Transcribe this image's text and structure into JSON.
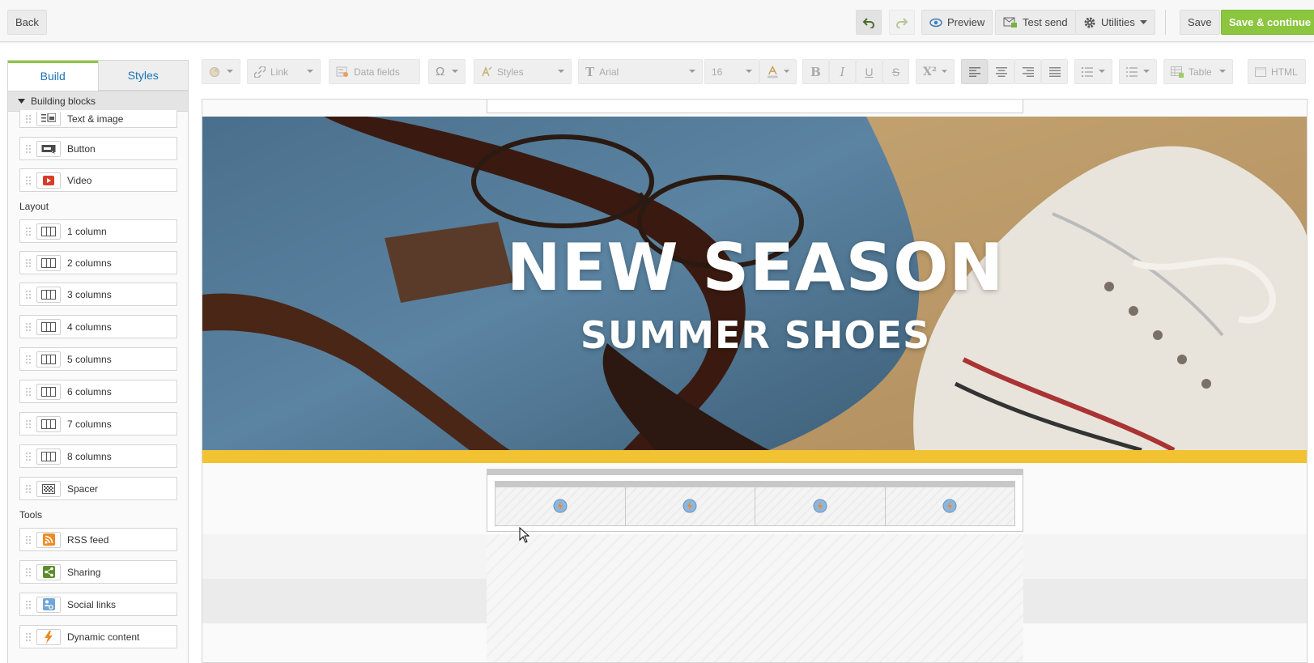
{
  "topbar": {
    "back_label": "Back",
    "preview_label": "Preview",
    "test_send_label": "Test send",
    "utilities_label": "Utilities",
    "save_label": "Save",
    "save_continue_label": "Save & continue",
    "accent_color": "#8cc63e"
  },
  "sidebar": {
    "tabs": [
      {
        "label": "Build",
        "active": true
      },
      {
        "label": "Styles",
        "active": false
      }
    ],
    "section_title": "Building blocks",
    "building_blocks": [
      {
        "label": "Text & image",
        "icon": "text-image-icon"
      },
      {
        "label": "Button",
        "icon": "button-block-icon"
      },
      {
        "label": "Video",
        "icon": "video-icon"
      }
    ],
    "layout_label": "Layout",
    "layout_blocks": [
      {
        "label": "1 column",
        "icon": "columns-icon"
      },
      {
        "label": "2 columns",
        "icon": "columns-icon"
      },
      {
        "label": "3 columns",
        "icon": "columns-icon"
      },
      {
        "label": "4 columns",
        "icon": "columns-icon"
      },
      {
        "label": "5 columns",
        "icon": "columns-icon"
      },
      {
        "label": "6 columns",
        "icon": "columns-icon"
      },
      {
        "label": "7 columns",
        "icon": "columns-icon"
      },
      {
        "label": "8 columns",
        "icon": "columns-icon"
      },
      {
        "label": "Spacer",
        "icon": "spacer-icon"
      }
    ],
    "tools_label": "Tools",
    "tool_blocks": [
      {
        "label": "RSS feed",
        "icon": "rss-icon"
      },
      {
        "label": "Sharing",
        "icon": "sharing-icon"
      },
      {
        "label": "Social links",
        "icon": "social-links-icon"
      },
      {
        "label": "Dynamic content",
        "icon": "dynamic-content-icon"
      }
    ]
  },
  "editor_toolbar": {
    "link_label": "Link",
    "data_fields_label": "Data fields",
    "special_char_label": "Ω",
    "styles_label": "Styles",
    "font_label": "Arial",
    "font_size": "16",
    "bold_label": "B",
    "italic_label": "I",
    "underline_label": "U",
    "strike_label": "S",
    "superscript_label": "X²",
    "table_label": "Table",
    "html_label": "HTML"
  },
  "canvas": {
    "hero_title": "NEW SEASON",
    "hero_subtitle": "SUMMER SHOES",
    "divider_color": "#f1c232",
    "column_cells": 4
  }
}
